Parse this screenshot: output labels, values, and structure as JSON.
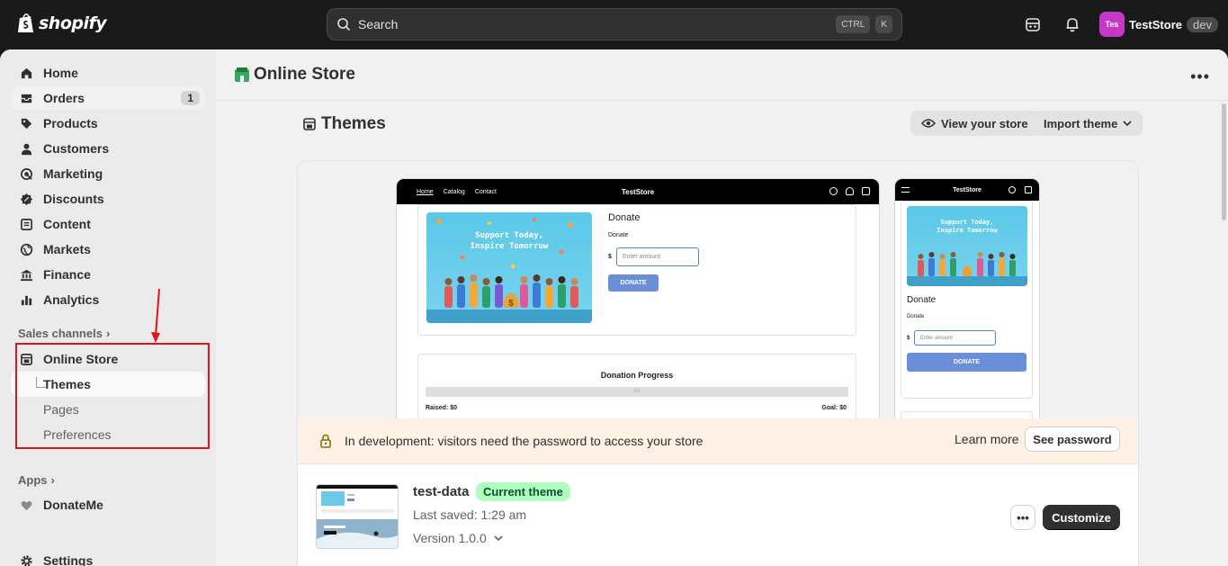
{
  "topbar": {
    "logo_text": "shopify",
    "search_label": "Search",
    "shortcut_keys": [
      "CTRL",
      "K"
    ],
    "avatar_initials": "Tes",
    "store_name": "TestStore",
    "store_badge": "dev",
    "icons": [
      "search-icon",
      "store-switcher-icon",
      "bell-icon"
    ]
  },
  "sidebar": {
    "items": [
      {
        "label": "Home",
        "icon": "home-icon"
      },
      {
        "label": "Orders",
        "icon": "orders-icon",
        "count": "1"
      },
      {
        "label": "Products",
        "icon": "tag-icon"
      },
      {
        "label": "Customers",
        "icon": "person-icon"
      },
      {
        "label": "Marketing",
        "icon": "target-icon"
      },
      {
        "label": "Discounts",
        "icon": "discount-icon"
      },
      {
        "label": "Content",
        "icon": "content-icon"
      },
      {
        "label": "Markets",
        "icon": "globe-icon"
      },
      {
        "label": "Finance",
        "icon": "bank-icon"
      },
      {
        "label": "Analytics",
        "icon": "chart-icon"
      }
    ],
    "sales_channels_label": "Sales channels",
    "online_store_label": "Online Store",
    "sub_items": [
      "Themes",
      "Pages",
      "Preferences"
    ],
    "apps_label": "Apps",
    "app_item": "DonateMe",
    "settings_label": "Settings"
  },
  "page": {
    "title": "Online Store",
    "section_title": "Themes",
    "view_store_label": "View your store",
    "import_theme_label": "Import theme"
  },
  "preview": {
    "desktop_nav": [
      "Home",
      "Catalog",
      "Contact"
    ],
    "store_title": "TestStore",
    "banner_text_1": "Support Today,",
    "banner_text_2": "Inspire Tomorrow",
    "donate_heading": "Donate",
    "donate_sub": "Donate",
    "currency": "$",
    "amount_placeholder": "Enter amount",
    "donate_button": "DONATE",
    "progress_title": "Donation Progress",
    "progress_value": "0/0",
    "raised": "Raised: $0",
    "goal": "Goal: $0"
  },
  "dev_notice": {
    "text": "In development: visitors need the password to access your store",
    "learn_more": "Learn more",
    "see_password": "See password"
  },
  "theme": {
    "name": "test-data",
    "badge": "Current theme",
    "last_saved": "Last saved: 1:29 am",
    "version": "Version 1.0.0",
    "customize_label": "Customize",
    "more_label": "•••"
  },
  "colors": {
    "annotation": "#e3131c",
    "current_badge_bg": "#affebf",
    "dev_strip_bg": "#fff1e3"
  }
}
